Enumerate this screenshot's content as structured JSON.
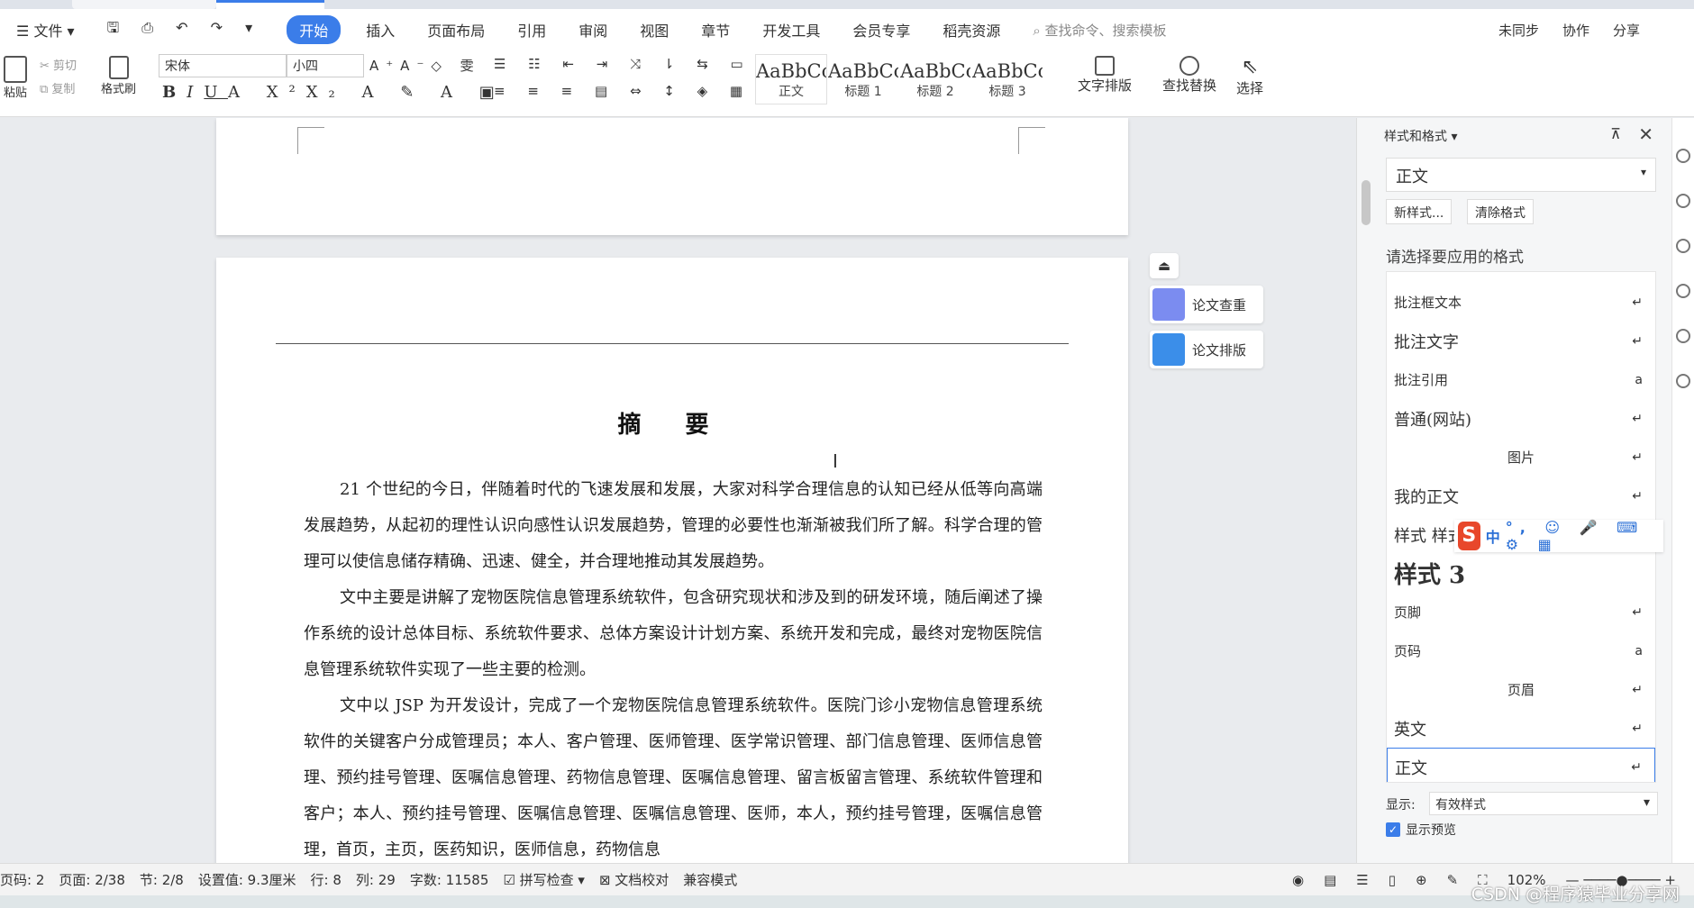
{
  "menubar": {
    "file": "文件",
    "tabs": [
      "开始",
      "插入",
      "页面布局",
      "引用",
      "审阅",
      "视图",
      "章节",
      "开发工具",
      "会员专享",
      "稻壳资源"
    ],
    "search_placeholder": "查找命令、搜索模板",
    "right": [
      "未同步",
      "协作",
      "分享"
    ]
  },
  "ribbon": {
    "paste": "粘贴",
    "cut": "剪切",
    "copy": "复制",
    "format_painter": "格式刷",
    "font_name": "宋体",
    "font_size": "小四",
    "styles": [
      {
        "preview": "AaBbCcI",
        "name": "正文"
      },
      {
        "preview": "AaBbCcl",
        "name": "标题 1"
      },
      {
        "preview": "AaBbCcI",
        "name": "标题 2"
      },
      {
        "preview": "AaBbCc",
        "name": "标题 3"
      }
    ],
    "text_layout": "文字排版",
    "find_replace": "查找替换",
    "select": "选择"
  },
  "float_buttons": [
    "论文查重",
    "论文排版"
  ],
  "document": {
    "title": "摘  要",
    "paragraphs": [
      "21 个世纪的今日，伴随着时代的飞速发展和发展，大家对科学合理信息的认知已经从低等向高端发展趋势，从起初的理性认识向感性认识发展趋势，管理的必要性也渐渐被我们所了解。科学合理的管理可以使信息储存精确、迅速、健全，并合理地推动其发展趋势。",
      "文中主要是讲解了宠物医院信息管理系统软件，包含研究现状和涉及到的研发环境，随后阐述了操作系统的设计总体目标、系统软件要求、总体方案设计计划方案、系统开发和完成，最终对宠物医院信息管理系统软件实现了一些主要的检测。",
      "文中以 JSP 为开发设计，完成了一个宠物医院信息管理系统软件。医院门诊小宠物信息管理系统软件的关键客户分成管理员；本人、客户管理、医师管理、医学常识管理、部门信息管理、医师信息管理、预约挂号管理、医嘱信息管理、药物信息管理、医嘱信息管理、留言板留言管理、系统软件管理和客户；本人、预约挂号管理、医嘱信息管理、医嘱信息管理、医师，本人，预约挂号管理，医嘱信息管理，首页，主页，医药知识，医师信息，药物信息"
    ]
  },
  "panel": {
    "title": "样式和格式",
    "current_style": "正文",
    "new_style": "新样式...",
    "clear_format": "清除格式",
    "apply_label": "请选择要应用的格式",
    "styles": [
      {
        "name": "批注框文本",
        "mark": "↵",
        "kind": "small"
      },
      {
        "name": "批注文字",
        "mark": "↵",
        "kind": ""
      },
      {
        "name": "批注引用",
        "mark": "a",
        "kind": "small"
      },
      {
        "name": "普通(网站)",
        "mark": "↵",
        "kind": ""
      },
      {
        "name": "图片",
        "mark": "↵",
        "kind": "center small"
      },
      {
        "name": "我的正文",
        "mark": "↵",
        "kind": ""
      },
      {
        "name": "样式 样式 论文正文 +(符号)",
        "mark": "↵",
        "kind": ""
      },
      {
        "name": "样式 3",
        "mark": "",
        "kind": "big"
      },
      {
        "name": "页脚",
        "mark": "↵",
        "kind": "small"
      },
      {
        "name": "页码",
        "mark": "a",
        "kind": "small"
      },
      {
        "name": "页眉",
        "mark": "↵",
        "kind": "center small"
      },
      {
        "name": "英文",
        "mark": "↵",
        "kind": ""
      },
      {
        "name": "正文",
        "mark": "↵",
        "kind": "sel"
      }
    ],
    "show_label": "显示:",
    "show_value": "有效样式",
    "preview_label": "显示预览",
    "ime": "中"
  },
  "statusbar": {
    "items": [
      "页码: 2",
      "页面: 2/38",
      "节: 2/8",
      "设置值: 9.3厘米",
      "行: 8",
      "列: 29",
      "字数: 11585",
      "拼写检查",
      "文档校对",
      "兼容模式"
    ],
    "zoom": "102%"
  },
  "watermark": "CSDN @程序猿毕业分享网"
}
